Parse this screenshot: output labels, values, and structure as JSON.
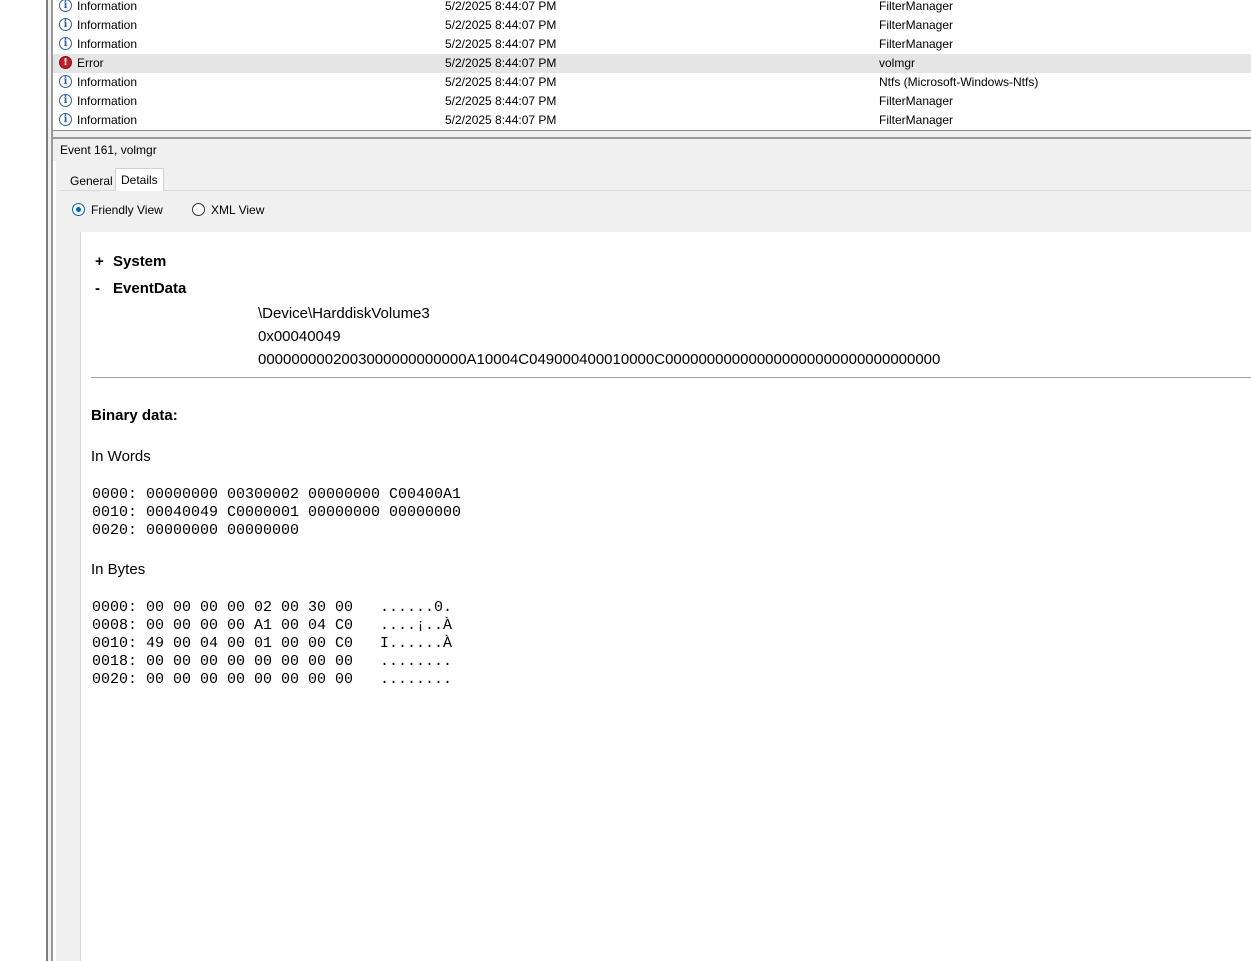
{
  "events": [
    {
      "level": "Information",
      "datetime": "5/2/2025 8:44:07 PM",
      "source": "FilterManager",
      "icon": "info-icon"
    },
    {
      "level": "Information",
      "datetime": "5/2/2025 8:44:07 PM",
      "source": "FilterManager",
      "icon": "info-icon"
    },
    {
      "level": "Information",
      "datetime": "5/2/2025 8:44:07 PM",
      "source": "FilterManager",
      "icon": "info-icon"
    },
    {
      "level": "Error",
      "datetime": "5/2/2025 8:44:07 PM",
      "source": "volmgr",
      "icon": "error-icon"
    },
    {
      "level": "Information",
      "datetime": "5/2/2025 8:44:07 PM",
      "source": "Ntfs (Microsoft-Windows-Ntfs)",
      "icon": "info-icon"
    },
    {
      "level": "Information",
      "datetime": "5/2/2025 8:44:07 PM",
      "source": "FilterManager",
      "icon": "info-icon"
    },
    {
      "level": "Information",
      "datetime": "5/2/2025 8:44:07 PM",
      "source": "FilterManager",
      "icon": "info-icon"
    }
  ],
  "detail": {
    "header": "Event 161, volmgr",
    "tabs": [
      "General",
      "Details"
    ],
    "view_options": [
      "Friendly View",
      "XML View"
    ],
    "selected_view": "Friendly View",
    "system_sign": "+",
    "system_label": "System",
    "eventdata_sign": "-",
    "eventdata_label": "EventData",
    "eventdata_values": [
      "\\Device\\HarddiskVolume3",
      "0x00040049",
      "0000000002003000000000000A10004C049000400010000C000000000000000000000000000000000"
    ],
    "binary_title": "Binary data:",
    "words_title": "In Words",
    "words_lines": [
      "0000: 00000000 00300002 00000000 C00400A1",
      "0010: 00040049 C0000001 00000000 00000000",
      "0020: 00000000 00000000"
    ],
    "bytes_title": "In Bytes",
    "bytes_lines": [
      "0000: 00 00 00 00 02 00 30 00   ......0.",
      "0008: 00 00 00 00 A1 00 04 C0   ....¡..À",
      "0010: 49 00 04 00 01 00 00 C0   I......À",
      "0018: 00 00 00 00 00 00 00 00   ........",
      "0020: 00 00 00 00 00 00 00 00   ........"
    ]
  }
}
